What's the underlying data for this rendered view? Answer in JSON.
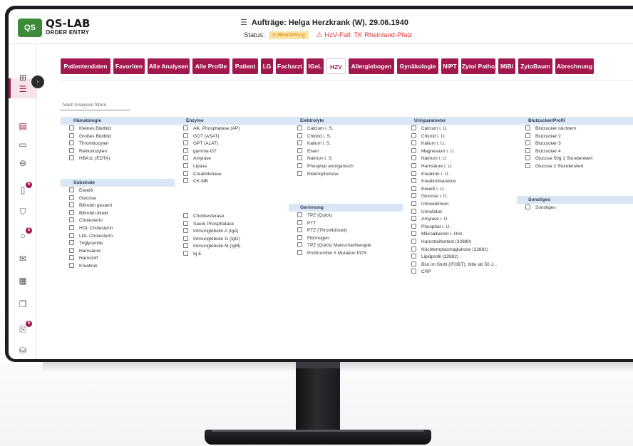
{
  "header": {
    "logo_mark": "QS",
    "app_title": "QS-LAB",
    "app_subtitle": "ORDER ENTRY",
    "title_icon": "list-icon",
    "title": "Aufträge: Helga Herzkrank (W), 29.06.1940",
    "status_label": "Status:",
    "status_value": "In Bearbeitung",
    "warning_icon": "warning-triangle-icon",
    "case_info": "HzV-Fall: TK Rheinland-Pfalz"
  },
  "sidebar": {
    "icons": [
      "grid-icon",
      "list-icon",
      "form-icon",
      "chat-icon",
      "flask-icon",
      "document-icon",
      "cart-icon",
      "info-icon",
      "mail-icon",
      "clipboard-icon",
      "copy-icon",
      "export-icon",
      "database-icon"
    ],
    "badges": [
      "5",
      "5",
      "5"
    ],
    "collapse_icon": "chevron-right-icon"
  },
  "tabs": [
    "Patientendaten",
    "Favoriten",
    "Alle Analysen",
    "Alle Profile",
    "Patient",
    "LG",
    "Facharzt",
    "IGeL",
    "HZV",
    "Allergiebogen",
    "Gynäkologie",
    "NIPT",
    "Zyto/ Patho",
    "MiBi",
    "ZytoBaum",
    "Abrechnung"
  ],
  "active_tab": "HZV",
  "filter_placeholder": "Nach Analysen filtern",
  "groups": {
    "haematologie": {
      "title": "Hämatologie",
      "items": [
        "Kleines Blutbild",
        "Großes Blutbild",
        "Thrombozyten",
        "Retikulozyten",
        "HBA1c (EDTA)"
      ]
    },
    "substrate": {
      "title": "Substrate",
      "items": [
        "Eiweiß",
        "Glucose",
        "Bilirubin gesamt",
        "Bilirubin direkt",
        "Cholesterin",
        "HDL Cholesterin",
        "LDL-Cholesterin",
        "Triglyceride",
        "Harnsäure",
        "Harnstoff",
        "Kreatinin"
      ]
    },
    "enzyme": {
      "title": "Enzyme",
      "items": [
        "Alk. Phosphatase (AP)",
        "GOT (ASAT)",
        "GPT (ALAT)",
        "gamma-GT",
        "Amylase",
        "Lipase",
        "Creatinkinase",
        "CK-MB"
      ]
    },
    "enzyme2": {
      "items": [
        "Cholinesterase",
        "Saure Phosphatase",
        "Immunglobulin A (IgA)",
        "Immunglobulin G (IgG)",
        "Immunglobulin M (IgM)",
        "Ig E"
      ]
    },
    "elektrolyte": {
      "title": "Elektrolyte",
      "items": [
        "Calcium i. S.",
        "Chlorid i. S.",
        "Kalium i. S.",
        "Eisen",
        "Natrium i. S.",
        "Phosphat anorganisch",
        "Elektrophorese"
      ]
    },
    "gerinnung": {
      "title": "Gerinnung",
      "items": [
        "TPZ (Quick)",
        "PTT",
        "PTZ (Thrombinzeit)",
        "Fibrinogen",
        "TPZ (Quick) Markumartherapie",
        "Prothrombin II Mutation PCR"
      ]
    },
    "urin": {
      "title": "Urinparameter",
      "items": [
        "Calcium i. U.",
        "Chlorid i. U.",
        "Kalium i. U.",
        "Magnesium i. U.",
        "Natrium i. U.",
        "Harnsäure i. U.",
        "Kreatinin i. U.",
        "Kreatinclearance",
        "Eiweiß i. U.",
        "Glucose i. U.",
        "Urinsediment",
        "Urinstatus",
        "Amylase i. U.",
        "Phosphat i. U.",
        "Mikroalbumin i. Urin",
        "Harnstreifentest (32880)",
        "Nüchternplasmaglukose (32881)",
        "Lipidprofil (32882)",
        "Blut im Stuhl (IFOBT), bitte ab 50 J...",
        "CRP"
      ]
    },
    "blutzucker": {
      "title": "Blutzucker/Profil",
      "items": [
        "Blutzucker nüchtern",
        "Blutzucker 2",
        "Blutzucker 3",
        "Blutzucker 4",
        "Glucose 50g 1 Stundenwert",
        "Glucose 2 Stundenwert"
      ]
    },
    "sonstiges": {
      "title": "Sonstiges",
      "items": [
        "Sonstiges"
      ]
    }
  },
  "colors": {
    "accent": "#a3174f",
    "group_header": "#d9e6f5",
    "logo": "#3d8b37",
    "warning": "#e03434"
  }
}
